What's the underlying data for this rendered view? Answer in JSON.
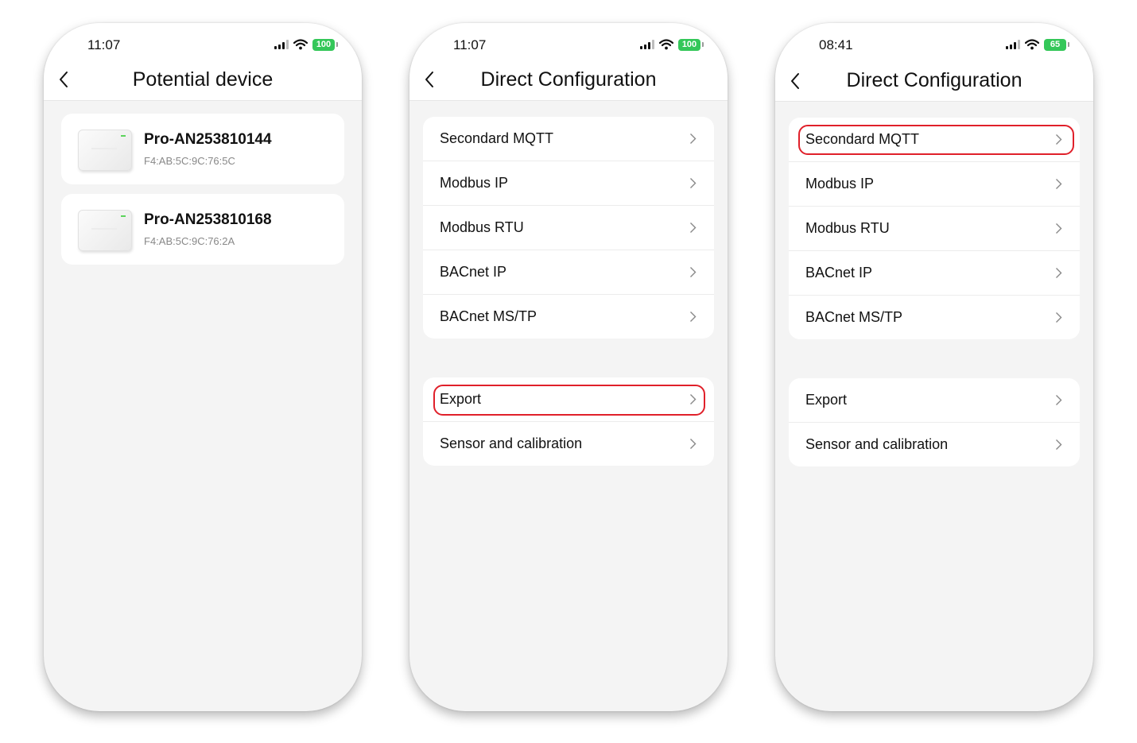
{
  "phones": [
    {
      "status_time": "11:07",
      "battery": "100",
      "title": "Potential device",
      "devices": [
        {
          "name": "Pro-AN253810144",
          "mac": "F4:AB:5C:9C:76:5C"
        },
        {
          "name": "Pro-AN253810168",
          "mac": "F4:AB:5C:9C:76:2A"
        }
      ]
    },
    {
      "status_time": "11:07",
      "battery": "100",
      "title": "Direct Configuration",
      "group1": [
        "Secondard MQTT",
        "Modbus IP",
        "Modbus RTU",
        "BACnet IP",
        "BACnet MS/TP"
      ],
      "group2": [
        "Export",
        "Sensor and calibration"
      ],
      "highlighted": "Export"
    },
    {
      "status_time": "08:41",
      "battery": "65",
      "title": "Direct Configuration",
      "group1": [
        "Secondard MQTT",
        "Modbus IP",
        "Modbus RTU",
        "BACnet IP",
        "BACnet MS/TP"
      ],
      "group2": [
        "Export",
        "Sensor and calibration"
      ],
      "highlighted": "Secondard MQTT"
    }
  ],
  "icons": {
    "back": "chevron-left-icon",
    "row": "chevron-right-icon",
    "signal": "cellular-signal-icon",
    "wifi": "wifi-icon",
    "battery": "battery-icon"
  },
  "colors": {
    "highlight": "#e0202a",
    "battery": "#34c759",
    "background": "#f4f4f4"
  }
}
